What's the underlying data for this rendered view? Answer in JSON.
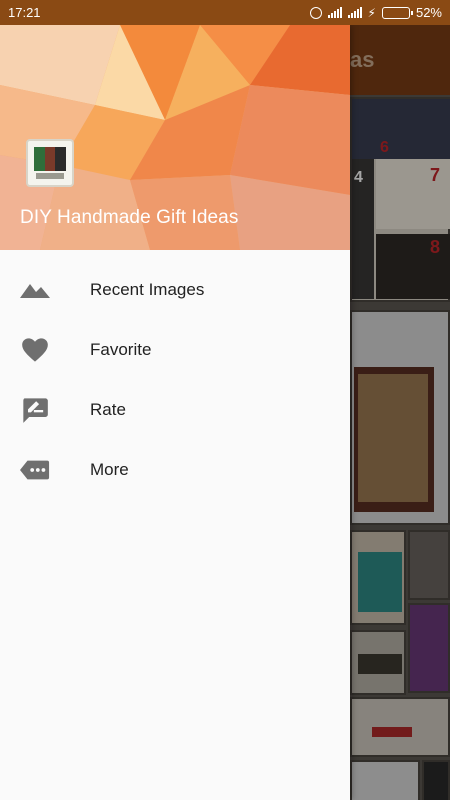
{
  "status_bar": {
    "time": "17:21",
    "battery_percent": "52%",
    "battery_level": 0.52,
    "battery_color": "#3fd23f"
  },
  "drawer": {
    "app_title": "DIY Handmade Gift Ideas",
    "items": [
      {
        "label": "Recent Images",
        "icon": "landscape-icon"
      },
      {
        "label": "Favorite",
        "icon": "heart-icon"
      },
      {
        "label": "Rate",
        "icon": "rate-review-icon"
      },
      {
        "label": "More",
        "icon": "more-tag-icon"
      }
    ]
  },
  "background_app": {
    "toolbar_fragment": "as",
    "tile_numbers": [
      "6",
      "4",
      "7",
      "8"
    ]
  },
  "colors": {
    "status_bar": "#8a4a14",
    "toolbar": "#7a3c14",
    "icon_gray": "#6f6f6f"
  }
}
